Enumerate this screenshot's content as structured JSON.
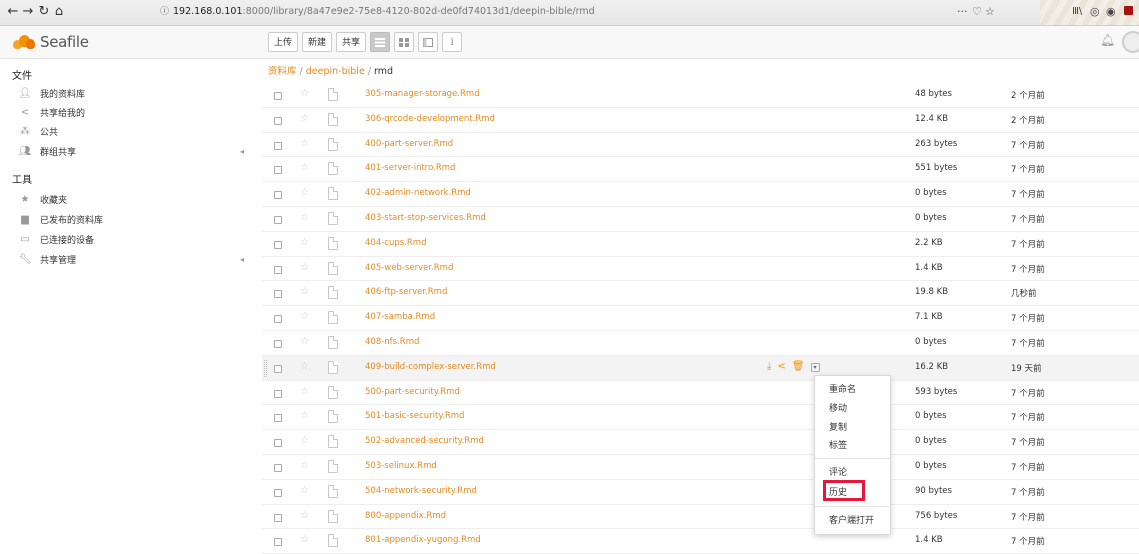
{
  "browser": {
    "url_host": "192.168.0.101",
    "url_path": ":8000/library/8a47e9e2-75e8-4120-802d-de0fd74013d1/deepin-bible/rmd",
    "right_icons": [
      "···",
      "♡",
      "☆"
    ]
  },
  "app": {
    "logo_text": "Seafile",
    "toolbar": {
      "upload": "上传",
      "new": "新建",
      "share": "共享"
    }
  },
  "sidebar": {
    "files_title": "文件",
    "files_items": [
      {
        "label": "我的资料库",
        "icon": "user-icon"
      },
      {
        "label": "共享给我的",
        "icon": "share-icon"
      },
      {
        "label": "公共",
        "icon": "public-icon"
      },
      {
        "label": "群组共享",
        "icon": "group-icon"
      }
    ],
    "tools_title": "工具",
    "tools_items": [
      {
        "label": "收藏夹",
        "icon": "star-icon"
      },
      {
        "label": "已发布的资料库",
        "icon": "wiki-icon"
      },
      {
        "label": "已连接的设备",
        "icon": "monitor-icon"
      },
      {
        "label": "共享管理",
        "icon": "wrench-icon"
      }
    ]
  },
  "breadcrumb": {
    "root": "资料库",
    "repo": "deepin-bible",
    "current": "rmd",
    "sep": " / "
  },
  "files": [
    {
      "name": "305-manager-storage.Rmd",
      "size": "48 bytes",
      "mtime": "2 个月前"
    },
    {
      "name": "306-qrcode-development.Rmd",
      "size": "12.4 KB",
      "mtime": "2 个月前"
    },
    {
      "name": "400-part-server.Rmd",
      "size": "263 bytes",
      "mtime": "7 个月前"
    },
    {
      "name": "401-server-intro.Rmd",
      "size": "551 bytes",
      "mtime": "7 个月前"
    },
    {
      "name": "402-admin-network.Rmd",
      "size": "0 bytes",
      "mtime": "7 个月前"
    },
    {
      "name": "403-start-stop-services.Rmd",
      "size": "0 bytes",
      "mtime": "7 个月前"
    },
    {
      "name": "404-cups.Rmd",
      "size": "2.2 KB",
      "mtime": "7 个月前"
    },
    {
      "name": "405-web-server.Rmd",
      "size": "1.4 KB",
      "mtime": "7 个月前"
    },
    {
      "name": "406-ftp-server.Rmd",
      "size": "19.8 KB",
      "mtime": "几秒前"
    },
    {
      "name": "407-samba.Rmd",
      "size": "7.1 KB",
      "mtime": "7 个月前"
    },
    {
      "name": "408-nfs.Rmd",
      "size": "0 bytes",
      "mtime": "7 个月前"
    },
    {
      "name": "409-build-complex-server.Rmd",
      "size": "16.2 KB",
      "mtime": "19 天前"
    },
    {
      "name": "500-part-security.Rmd",
      "size": "593 bytes",
      "mtime": "7 个月前"
    },
    {
      "name": "501-basic-security.Rmd",
      "size": "0 bytes",
      "mtime": "7 个月前"
    },
    {
      "name": "502-advanced-security.Rmd",
      "size": "0 bytes",
      "mtime": "7 个月前"
    },
    {
      "name": "503-selinux.Rmd",
      "size": "0 bytes",
      "mtime": "7 个月前"
    },
    {
      "name": "504-network-security.Rmd",
      "size": "90 bytes",
      "mtime": "7 个月前"
    },
    {
      "name": "800-appendix.Rmd",
      "size": "756 bytes",
      "mtime": "7 个月前"
    },
    {
      "name": "801-appendix-yugong.Rmd",
      "size": "1.4 KB",
      "mtime": "7 个月前"
    }
  ],
  "menu": {
    "rename": "重命名",
    "move": "移动",
    "copy": "复制",
    "tags": "标签",
    "comment": "评论",
    "history": "历史",
    "open_client": "客户端打开"
  },
  "colors": {
    "accent": "#e48a1e",
    "highlight": "#e6173a"
  }
}
